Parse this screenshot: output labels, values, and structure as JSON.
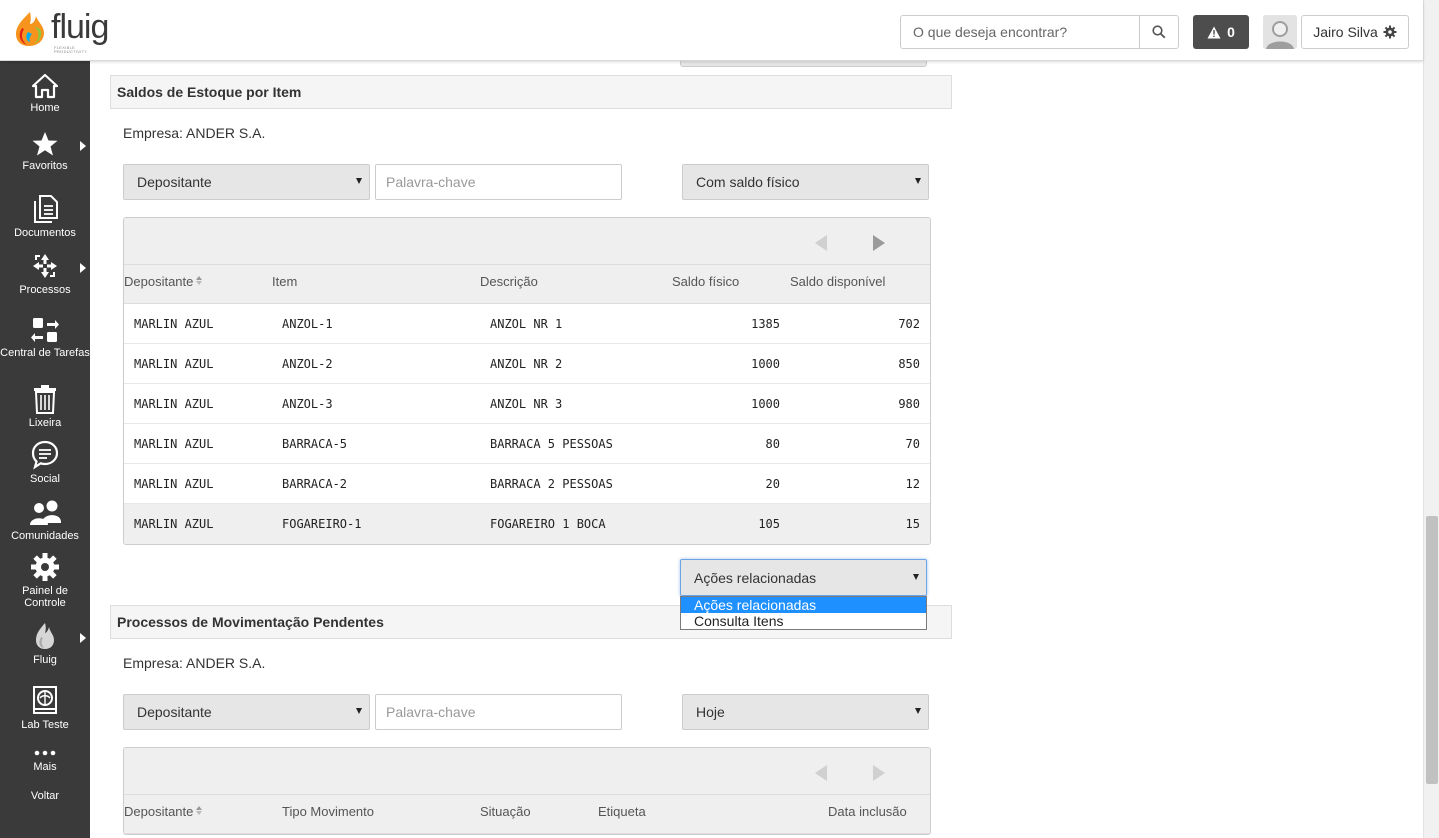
{
  "header": {
    "logo_text": "fluig",
    "logo_tagline": "FLEXIBLE PRODUCTIVITY",
    "search_placeholder": "O que deseja encontrar?",
    "alerts_count": "0",
    "user_name": "Jairo Silva"
  },
  "sidebar": {
    "items": [
      {
        "label": "Home",
        "icon": "home-icon"
      },
      {
        "label": "Favoritos",
        "icon": "star-icon"
      },
      {
        "label": "Documentos",
        "icon": "documents-icon"
      },
      {
        "label": "Processos",
        "icon": "processes-icon"
      },
      {
        "label": "Central de Tarefas",
        "icon": "task-center-icon"
      },
      {
        "label": "Lixeira",
        "icon": "trash-icon"
      },
      {
        "label": "Social",
        "icon": "chat-bubble-icon"
      },
      {
        "label": "Comunidades",
        "icon": "communities-icon"
      },
      {
        "label": "Painel de Controle",
        "icon": "gear-icon"
      },
      {
        "label": "Fluig",
        "icon": "fluig-flame-icon"
      },
      {
        "label": "Lab Teste",
        "icon": "lab-icon"
      },
      {
        "label": "Mais",
        "icon": "more-dots-icon"
      },
      {
        "label": "Voltar"
      }
    ]
  },
  "stock_section": {
    "title": "Saldos de Estoque por Item",
    "empresa": "Empresa: ANDER S.A.",
    "depositante_select": "Depositante",
    "keyword_placeholder": "Palavra-chave",
    "balance_filter": "Com saldo físico",
    "columns": [
      "Depositante",
      "Item",
      "Descrição",
      "Saldo físico",
      "Saldo disponível"
    ],
    "rows": [
      {
        "depositante": "MARLIN AZUL",
        "item": "ANZOL-1",
        "descricao": "ANZOL NR 1",
        "saldo_fisico": "1385",
        "saldo_disponivel": "702"
      },
      {
        "depositante": "MARLIN AZUL",
        "item": "ANZOL-2",
        "descricao": "ANZOL NR 2",
        "saldo_fisico": "1000",
        "saldo_disponivel": "850"
      },
      {
        "depositante": "MARLIN AZUL",
        "item": "ANZOL-3",
        "descricao": "ANZOL NR 3",
        "saldo_fisico": "1000",
        "saldo_disponivel": "980"
      },
      {
        "depositante": "MARLIN AZUL",
        "item": "BARRACA-5",
        "descricao": "BARRACA 5 PESSOAS",
        "saldo_fisico": "80",
        "saldo_disponivel": "70"
      },
      {
        "depositante": "MARLIN AZUL",
        "item": "BARRACA-2",
        "descricao": "BARRACA 2 PESSOAS",
        "saldo_fisico": "20",
        "saldo_disponivel": "12"
      },
      {
        "depositante": "MARLIN AZUL",
        "item": "FOGAREIRO-1",
        "descricao": "FOGAREIRO 1 BOCA",
        "saldo_fisico": "105",
        "saldo_disponivel": "15"
      }
    ],
    "actions_select": "Ações relacionadas",
    "actions_options": [
      "Ações relacionadas",
      "Consulta Itens"
    ]
  },
  "pending_section": {
    "title": "Processos de Movimentação Pendentes",
    "empresa": "Empresa: ANDER S.A.",
    "depositante_select": "Depositante",
    "keyword_placeholder": "Palavra-chave",
    "date_filter": "Hoje",
    "columns": [
      "Depositante",
      "Tipo Movimento",
      "Situação",
      "Etiqueta",
      "Data inclusão"
    ]
  }
}
